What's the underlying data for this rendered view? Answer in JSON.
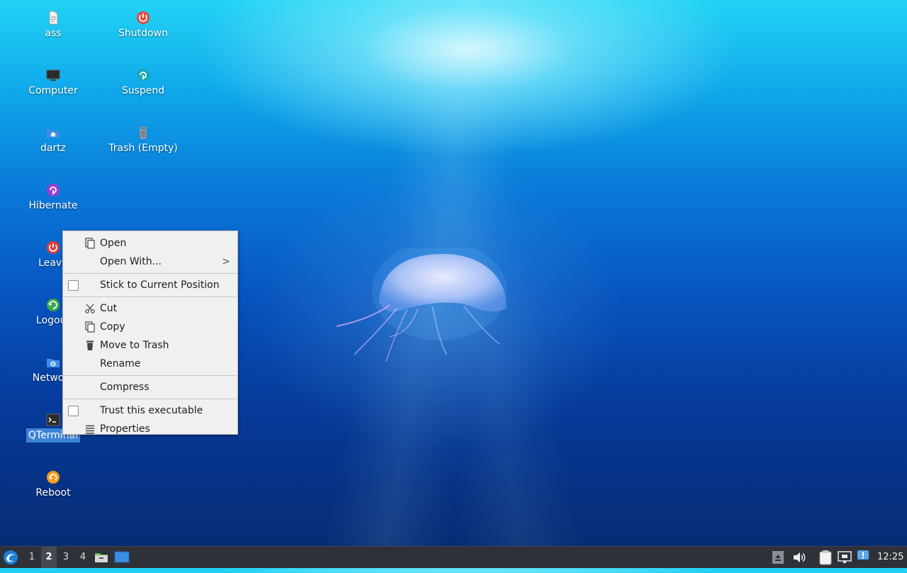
{
  "desktop": {
    "icons": [
      {
        "label": "ass",
        "icon": "text-file-icon"
      },
      {
        "label": "Shutdown",
        "icon": "power-icon"
      },
      {
        "label": "Computer",
        "icon": "computer-icon"
      },
      {
        "label": "Suspend",
        "icon": "suspend-icon"
      },
      {
        "label": "dartz",
        "icon": "home-folder-icon"
      },
      {
        "label": "Trash (Empty)",
        "icon": "trash-icon"
      },
      {
        "label": "Hibernate",
        "icon": "hibernate-icon"
      },
      {
        "label": "Leave",
        "icon": "leave-icon"
      },
      {
        "label": "Logout",
        "icon": "logout-icon"
      },
      {
        "label": "Network",
        "icon": "network-folder-icon"
      },
      {
        "label": "QTerminal",
        "icon": "terminal-icon",
        "selected": true
      },
      {
        "label": "Reboot",
        "icon": "reboot-icon"
      }
    ]
  },
  "context_menu": {
    "items": [
      {
        "label": "Open",
        "icon": "open-icon"
      },
      {
        "label": "Open With...",
        "submenu_arrow": ">"
      },
      {
        "label": "Stick to Current Position",
        "checkbox": false
      },
      {
        "label": "Cut",
        "icon": "scissors-icon"
      },
      {
        "label": "Copy",
        "icon": "copy-icon"
      },
      {
        "label": "Move to Trash",
        "icon": "trash-icon"
      },
      {
        "label": "Rename"
      },
      {
        "label": "Compress"
      },
      {
        "label": "Trust this executable",
        "checkbox": false
      },
      {
        "label": "Properties",
        "icon": "properties-icon"
      }
    ]
  },
  "taskbar": {
    "start_icon": "lxqt-logo-icon",
    "workspaces": [
      "1",
      "2",
      "3",
      "4"
    ],
    "active_workspace": "2",
    "quicklaunch": [
      "file-manager-icon",
      "show-desktop-icon"
    ],
    "tray": [
      "eject-icon",
      "volume-icon",
      "clipboard-icon",
      "network-icon",
      "notification-icon"
    ],
    "clock": "12:25"
  },
  "colors": {
    "selection": "#3d83d6",
    "menu_bg": "#f0f0f0",
    "taskbar_bg": "#2e3238"
  }
}
